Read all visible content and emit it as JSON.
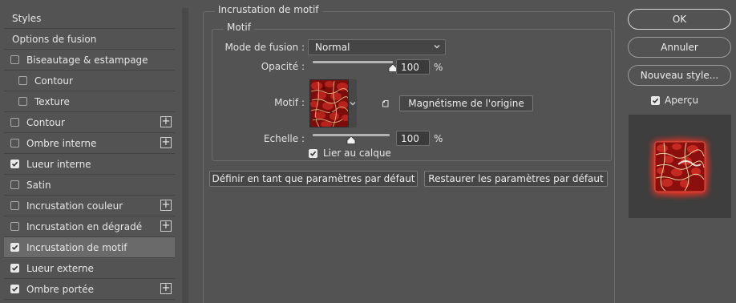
{
  "sidebar": {
    "items": [
      {
        "label": "Styles",
        "type": "header"
      },
      {
        "label": "Options de fusion",
        "type": "header"
      },
      {
        "label": "Biseautage & estampage",
        "checked": false,
        "indent": 0,
        "plus": false
      },
      {
        "label": "Contour",
        "checked": false,
        "indent": 1,
        "plus": false
      },
      {
        "label": "Texture",
        "checked": false,
        "indent": 1,
        "plus": false
      },
      {
        "label": "Contour",
        "checked": false,
        "indent": 0,
        "plus": true
      },
      {
        "label": "Ombre interne",
        "checked": false,
        "indent": 0,
        "plus": true
      },
      {
        "label": "Lueur interne",
        "checked": true,
        "indent": 0,
        "plus": false
      },
      {
        "label": "Satin",
        "checked": false,
        "indent": 0,
        "plus": false
      },
      {
        "label": "Incrustation couleur",
        "checked": false,
        "indent": 0,
        "plus": true
      },
      {
        "label": "Incrustation en dégradé",
        "checked": false,
        "indent": 0,
        "plus": true
      },
      {
        "label": "Incrustation de motif",
        "checked": true,
        "indent": 0,
        "plus": false,
        "selected": true
      },
      {
        "label": "Lueur externe",
        "checked": true,
        "indent": 0,
        "plus": false
      },
      {
        "label": "Ombre portée",
        "checked": true,
        "indent": 0,
        "plus": true
      }
    ],
    "plus_symbol": "+"
  },
  "panel": {
    "outer_title": "Incrustation de motif",
    "inner_title": "Motif",
    "blend_mode_label": "Mode de fusion :",
    "blend_mode_value": "Normal",
    "opacity_label": "Opacité :",
    "opacity_value": "100",
    "opacity_level": 1.0,
    "opacity_unit": "%",
    "pattern_label": "Motif :",
    "snap_origin_label": "Magnétisme de l'origine",
    "scale_label": "Echelle :",
    "scale_value": "100",
    "scale_level": 0.5,
    "scale_unit": "%",
    "link_layer_label": "Lier au calque",
    "link_layer_checked": true,
    "set_default_label": "Définir en tant que paramètres par défaut",
    "reset_default_label": "Restaurer les paramètres par défaut"
  },
  "right": {
    "ok_label": "OK",
    "cancel_label": "Annuler",
    "new_style_label": "Nouveau style...",
    "preview_label": "Aperçu",
    "preview_checked": true
  },
  "icons": {
    "check": "check-icon",
    "plus": "plus-icon",
    "chevron": "chevron-down-icon",
    "new_preset": "new-preset-icon",
    "slider_thumb": "slider-thumb-icon"
  },
  "colors": {
    "background": "#535353",
    "selected_row": "#6a6a6a",
    "pattern_red": "#8a0f0d",
    "glow": "#ff2a1a"
  }
}
